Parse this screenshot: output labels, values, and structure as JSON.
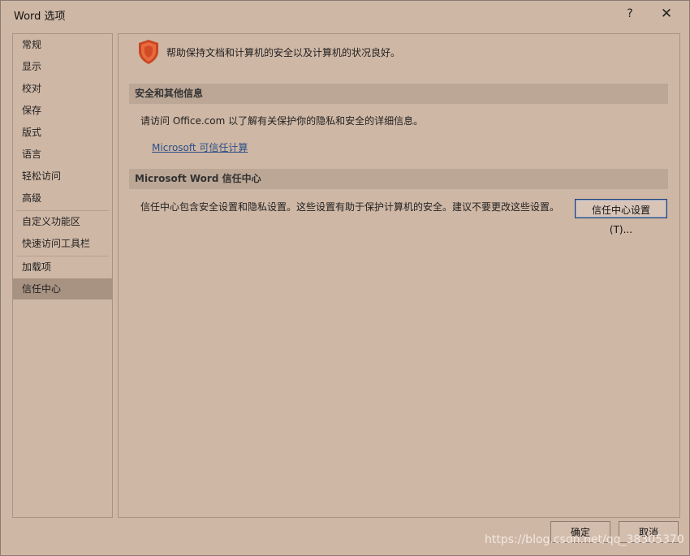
{
  "window": {
    "title": "Word 选项",
    "help_label": "?",
    "close_label": "✕"
  },
  "nav": {
    "items": [
      {
        "label": "常规"
      },
      {
        "label": "显示"
      },
      {
        "label": "校对"
      },
      {
        "label": "保存"
      },
      {
        "label": "版式"
      },
      {
        "label": "语言"
      },
      {
        "label": "轻松访问"
      },
      {
        "label": "高级"
      },
      {
        "label": "自定义功能区"
      },
      {
        "label": "快速访问工具栏"
      },
      {
        "label": "加载项"
      },
      {
        "label": "信任中心"
      }
    ],
    "selected": "信任中心"
  },
  "main": {
    "intro_text": "帮助保持文档和计算机的安全以及计算机的状况良好。",
    "shield_color": "#d9532b",
    "sections": [
      {
        "title": "安全和其他信息",
        "text": "请访问 Office.com  以了解有关保护你的隐私和安全的详细信息。",
        "link": "Microsoft 可信任计算"
      },
      {
        "title": "Microsoft Word 信任中心",
        "text": "信任中心包含安全设置和隐私设置。这些设置有助于保护计算机的安全。建议不要更改这些设置。",
        "button": "信任中心设置(T)..."
      }
    ]
  },
  "footer": {
    "ok_label": "确定",
    "cancel_label": "取消"
  },
  "watermark": "https://blog.csdn.net/qq_38305370",
  "colors": {
    "background": "#cfb7a5",
    "selected_nav": "#a89282",
    "section_header": "#bca796",
    "link": "#2b4f86"
  }
}
